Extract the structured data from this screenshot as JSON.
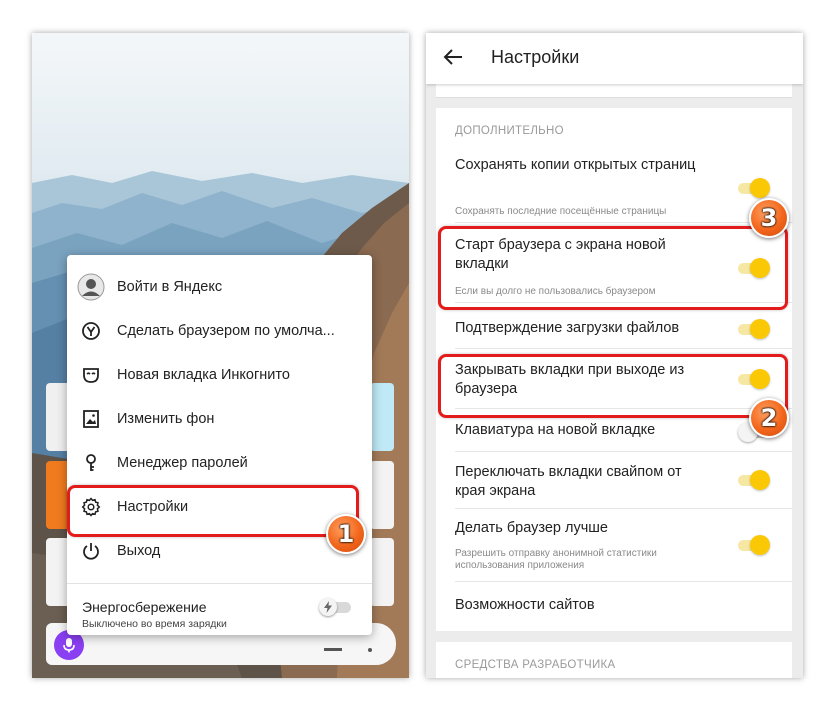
{
  "left_screen": {
    "menu": {
      "items": [
        {
          "label": "Войти в Яндекс",
          "icon": "user-avatar-icon"
        },
        {
          "label": "Сделать браузером по умолча...",
          "icon": "yandex-browser-icon"
        },
        {
          "label": "Новая вкладка Инкогнито",
          "icon": "incognito-mask-icon"
        },
        {
          "label": "Изменить фон",
          "icon": "image-icon"
        },
        {
          "label": "Менеджер паролей",
          "icon": "key-icon"
        },
        {
          "label": "Настройки",
          "icon": "gear-icon"
        },
        {
          "label": "Выход",
          "icon": "power-icon"
        }
      ],
      "energy": {
        "title": "Энергосбережение",
        "subtitle": "Выключено во время зарядки",
        "enabled": false
      }
    }
  },
  "right_screen": {
    "title": "Настройки",
    "section_additional": "ДОПОЛНИТЕЛЬНО",
    "settings": [
      {
        "title": "Сохранять копии открытых страниц",
        "subtitle": "Сохранять последние посещённые страницы",
        "enabled": true
      },
      {
        "title": "Старт браузера с экрана новой вкладки",
        "subtitle": "Если вы долго не пользовались браузером",
        "enabled": true
      },
      {
        "title": "Подтверждение загрузки файлов",
        "subtitle": "",
        "enabled": true
      },
      {
        "title": "Закрывать вкладки при выходе из браузера",
        "subtitle": "",
        "enabled": true
      },
      {
        "title": "Клавиатура на новой вкладке",
        "subtitle": "",
        "enabled": false
      },
      {
        "title": "Переключать вкладки свайпом от края экрана",
        "subtitle": "",
        "enabled": true
      },
      {
        "title": "Делать браузер лучше",
        "subtitle": "Разрешить отправку анонимной статистики использования приложения",
        "enabled": true
      }
    ],
    "site_capabilities": "Возможности сайтов",
    "section_dev": "СРЕДСТВА РАЗРАБОТЧИКА"
  },
  "annotations": {
    "step1": "1",
    "step2": "2",
    "step3": "3",
    "highlight_color": "#e31b1b",
    "badge_color": "#f2661c"
  },
  "colors": {
    "toggle_on": "#fbc805",
    "alice_button": "#8a3ff2",
    "orange_tile": "#f07b1f"
  }
}
